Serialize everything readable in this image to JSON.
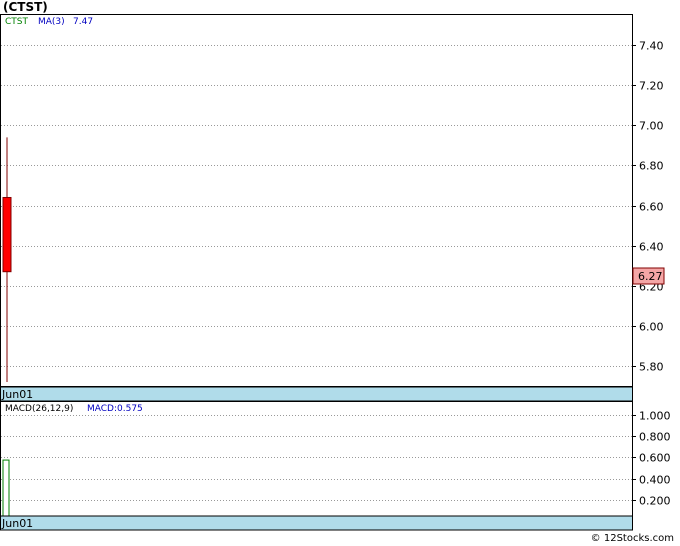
{
  "header": {
    "title": "(CTST)"
  },
  "footer": {
    "credit": "© 12Stocks.com"
  },
  "chart_data": [
    {
      "type": "candlestick",
      "legend": {
        "symbol": "CTST",
        "indicator": "MA(3)",
        "indicator_value": "7.47"
      },
      "ylim": [
        5.7,
        7.55
      ],
      "yticks": [
        "7.40",
        "7.20",
        "7.00",
        "6.80",
        "6.60",
        "6.40",
        "6.20",
        "6.00",
        "5.80"
      ],
      "xlabels": [
        "Jun01"
      ],
      "candles": [
        {
          "date": "Jun01",
          "open": 6.64,
          "high": 6.94,
          "low": 5.72,
          "close": 6.27
        }
      ],
      "last_price": "6.27",
      "colors": {
        "down": "#ff0000",
        "wick": "#800000",
        "price_tag": "#f4a6a6",
        "axis_band": "#b0dcea",
        "legend_symbol": "#008000",
        "legend_indicator": "#0000c0"
      }
    },
    {
      "type": "bar",
      "legend": {
        "indicator": "MACD(26,12,9)",
        "value_label": "MACD:0.575"
      },
      "ylim": [
        0.05,
        1.12
      ],
      "yticks": [
        "1.000",
        "0.800",
        "0.600",
        "0.400",
        "0.200"
      ],
      "xlabels": [
        "Jun01"
      ],
      "bars": [
        {
          "date": "Jun01",
          "value": 0.575
        }
      ],
      "colors": {
        "bar": "#008000"
      }
    }
  ]
}
